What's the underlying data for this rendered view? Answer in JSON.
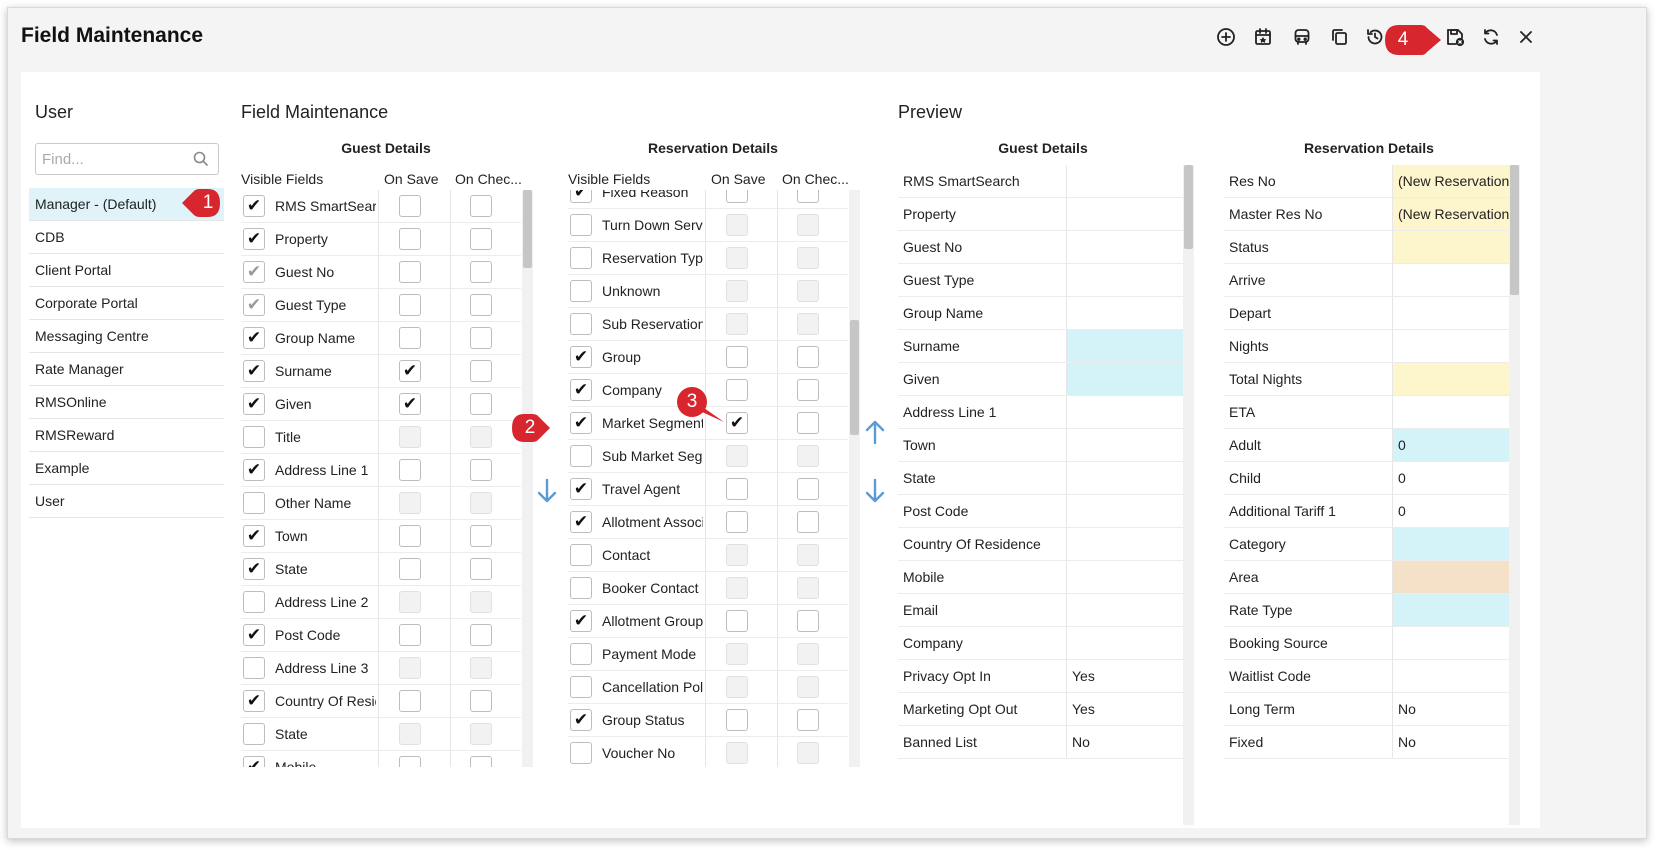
{
  "window": {
    "title": "Field Maintenance"
  },
  "toolbar": {
    "icons": [
      "add-circle-icon",
      "calendar-star-icon",
      "bus-icon",
      "copy-icon",
      "history-icon",
      "save-close-icon",
      "refresh-icon",
      "close-icon"
    ]
  },
  "user_panel": {
    "title": "User",
    "find_placeholder": "Find...",
    "items": [
      "Manager - (Default)",
      "CDB",
      "Client Portal",
      "Corporate Portal",
      "Messaging Centre",
      "Rate Manager",
      "RMSOnline",
      "RMSReward",
      "Example",
      "User"
    ],
    "selected_index": 0
  },
  "field_maintenance": {
    "title": "Field Maintenance",
    "guest": {
      "subtitle": "Guest Details",
      "headers": {
        "visible": "Visible Fields",
        "on_save": "On Save",
        "on_check": "On Chec..."
      },
      "rows": [
        {
          "label": "RMS SmartSearch",
          "visible": "checked",
          "on_save": "empty",
          "on_check": "empty"
        },
        {
          "label": "Property",
          "visible": "checked",
          "on_save": "empty",
          "on_check": "empty"
        },
        {
          "label": "Guest No",
          "visible": "gray",
          "on_save": "empty",
          "on_check": "empty"
        },
        {
          "label": "Guest Type",
          "visible": "gray",
          "on_save": "empty",
          "on_check": "empty"
        },
        {
          "label": "Group Name",
          "visible": "checked",
          "on_save": "empty",
          "on_check": "empty"
        },
        {
          "label": "Surname",
          "visible": "checked",
          "on_save": "checked",
          "on_check": "empty"
        },
        {
          "label": "Given",
          "visible": "checked",
          "on_save": "checked",
          "on_check": "empty"
        },
        {
          "label": "Title",
          "visible": "empty",
          "on_save": "disabled",
          "on_check": "disabled"
        },
        {
          "label": "Address Line 1",
          "visible": "checked",
          "on_save": "empty",
          "on_check": "empty"
        },
        {
          "label": "Other Name",
          "visible": "empty",
          "on_save": "disabled",
          "on_check": "disabled"
        },
        {
          "label": "Town",
          "visible": "checked",
          "on_save": "empty",
          "on_check": "empty"
        },
        {
          "label": "State",
          "visible": "checked",
          "on_save": "empty",
          "on_check": "empty"
        },
        {
          "label": "Address Line 2",
          "visible": "empty",
          "on_save": "disabled",
          "on_check": "disabled"
        },
        {
          "label": "Post Code",
          "visible": "checked",
          "on_save": "empty",
          "on_check": "empty"
        },
        {
          "label": "Address Line 3",
          "visible": "empty",
          "on_save": "disabled",
          "on_check": "disabled"
        },
        {
          "label": "Country Of Residence",
          "visible": "checked",
          "on_save": "empty",
          "on_check": "empty"
        },
        {
          "label": "State",
          "visible": "empty",
          "on_save": "disabled",
          "on_check": "disabled"
        },
        {
          "label": "Mobile",
          "visible": "checked",
          "on_save": "empty",
          "on_check": "empty"
        }
      ]
    },
    "reservation": {
      "subtitle": "Reservation Details",
      "headers": {
        "visible": "Visible Fields",
        "on_save": "On Save",
        "on_check": "On Chec..."
      },
      "rows": [
        {
          "label": "Fixed Reason",
          "visible": "checked",
          "on_save": "empty",
          "on_check": "empty"
        },
        {
          "label": "Turn Down Service",
          "visible": "empty",
          "on_save": "disabled",
          "on_check": "disabled"
        },
        {
          "label": "Reservation Type",
          "visible": "empty",
          "on_save": "disabled",
          "on_check": "disabled"
        },
        {
          "label": "Unknown",
          "visible": "empty",
          "on_save": "disabled",
          "on_check": "disabled"
        },
        {
          "label": "Sub Reservation Type",
          "visible": "empty",
          "on_save": "disabled",
          "on_check": "disabled"
        },
        {
          "label": "Group",
          "visible": "checked",
          "on_save": "empty",
          "on_check": "empty"
        },
        {
          "label": "Company",
          "visible": "checked",
          "on_save": "empty",
          "on_check": "empty"
        },
        {
          "label": "Market Segment",
          "visible": "checked",
          "on_save": "checked",
          "on_check": "empty"
        },
        {
          "label": "Sub Market Segment",
          "visible": "empty",
          "on_save": "disabled",
          "on_check": "disabled"
        },
        {
          "label": "Travel Agent",
          "visible": "checked",
          "on_save": "empty",
          "on_check": "empty"
        },
        {
          "label": "Allotment Association",
          "visible": "checked",
          "on_save": "empty",
          "on_check": "empty"
        },
        {
          "label": "Contact",
          "visible": "empty",
          "on_save": "disabled",
          "on_check": "disabled"
        },
        {
          "label": "Booker Contact",
          "visible": "empty",
          "on_save": "disabled",
          "on_check": "disabled"
        },
        {
          "label": "Allotment Group",
          "visible": "checked",
          "on_save": "empty",
          "on_check": "empty"
        },
        {
          "label": "Payment Mode",
          "visible": "empty",
          "on_save": "disabled",
          "on_check": "disabled"
        },
        {
          "label": "Cancellation Policy",
          "visible": "empty",
          "on_save": "disabled",
          "on_check": "disabled"
        },
        {
          "label": "Group Status",
          "visible": "checked",
          "on_save": "empty",
          "on_check": "empty"
        },
        {
          "label": "Voucher No",
          "visible": "empty",
          "on_save": "disabled",
          "on_check": "disabled"
        }
      ]
    }
  },
  "preview": {
    "title": "Preview",
    "guest": {
      "subtitle": "Guest Details",
      "rows": [
        {
          "label": "RMS SmartSearch",
          "value": "",
          "color": ""
        },
        {
          "label": "Property",
          "value": "",
          "color": ""
        },
        {
          "label": "Guest No",
          "value": "",
          "color": ""
        },
        {
          "label": "Guest Type",
          "value": "",
          "color": ""
        },
        {
          "label": "Group Name",
          "value": "",
          "color": ""
        },
        {
          "label": "Surname",
          "value": "",
          "color": "#d3f3f9"
        },
        {
          "label": "Given",
          "value": "",
          "color": "#d3f3f9"
        },
        {
          "label": "Address Line 1",
          "value": "",
          "color": ""
        },
        {
          "label": "Town",
          "value": "",
          "color": ""
        },
        {
          "label": "State",
          "value": "",
          "color": ""
        },
        {
          "label": "Post Code",
          "value": "",
          "color": ""
        },
        {
          "label": "Country Of Residence",
          "value": "",
          "color": ""
        },
        {
          "label": "Mobile",
          "value": "",
          "color": ""
        },
        {
          "label": "Email",
          "value": "",
          "color": ""
        },
        {
          "label": "Company",
          "value": "",
          "color": ""
        },
        {
          "label": "Privacy Opt In",
          "value": "Yes",
          "color": ""
        },
        {
          "label": "Marketing Opt Out",
          "value": "Yes",
          "color": ""
        },
        {
          "label": "Banned List",
          "value": "No",
          "color": ""
        }
      ]
    },
    "reservation": {
      "subtitle": "Reservation Details",
      "rows": [
        {
          "label": "Res No",
          "value": "(New Reservation)",
          "color": "#fdf5cc"
        },
        {
          "label": "Master Res No",
          "value": "(New Reservation)",
          "color": "#fdf5cc"
        },
        {
          "label": "Status",
          "value": "",
          "color": "#fdf5cc"
        },
        {
          "label": "Arrive",
          "value": "",
          "color": ""
        },
        {
          "label": "Depart",
          "value": "",
          "color": ""
        },
        {
          "label": "Nights",
          "value": "",
          "color": ""
        },
        {
          "label": "Total Nights",
          "value": "",
          "color": "#fdf5cc"
        },
        {
          "label": "ETA",
          "value": "",
          "color": ""
        },
        {
          "label": "Adult",
          "value": "0",
          "color": "#d3f3f9"
        },
        {
          "label": "Child",
          "value": "0",
          "color": ""
        },
        {
          "label": "Additional Tariff 1",
          "value": "0",
          "color": ""
        },
        {
          "label": "Category",
          "value": "",
          "color": "#d3f3f9"
        },
        {
          "label": "Area",
          "value": "",
          "color": "#f5e0c8"
        },
        {
          "label": "Rate Type",
          "value": "",
          "color": "#d3f3f9"
        },
        {
          "label": "Booking Source",
          "value": "",
          "color": ""
        },
        {
          "label": "Waitlist Code",
          "value": "",
          "color": ""
        },
        {
          "label": "Long Term",
          "value": "No",
          "color": ""
        },
        {
          "label": "Fixed",
          "value": "No",
          "color": ""
        }
      ]
    }
  },
  "callouts": [
    "1",
    "2",
    "3",
    "4"
  ],
  "colors": {
    "accent": "#5b9bd5",
    "callout": "#d7262e",
    "selected": "#dff3f8",
    "required": "#d3f3f9",
    "readonly": "#fdf5cc",
    "area": "#f5e0c8"
  }
}
